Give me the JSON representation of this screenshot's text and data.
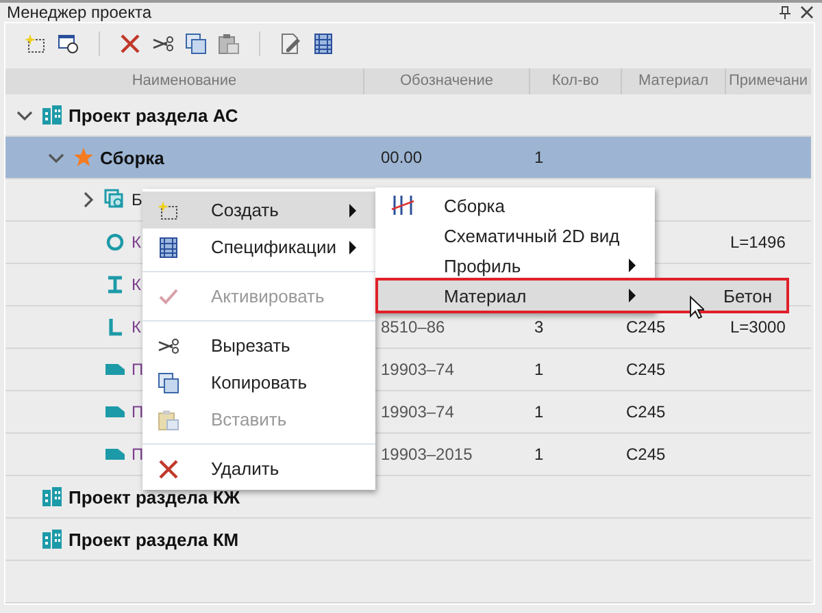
{
  "window": {
    "title": "Менеджер проекта"
  },
  "columns": [
    "Наименование",
    "Обозначение",
    "Кол-во",
    "Материал",
    "Примечани"
  ],
  "tree": [
    {
      "kind": "section",
      "name": "Проект раздела АС",
      "expanded": true,
      "selected": false,
      "children": [
        {
          "kind": "assembly",
          "name": "Сборка",
          "designation": "00.00",
          "quantity": "1",
          "expanded": true,
          "selected": true,
          "children": [
            {
              "kind": "group",
              "name": "Б",
              "expanded": false,
              "selected": false
            },
            {
              "kind": "ring",
              "name": "К",
              "note": "L=1496",
              "selected": false
            },
            {
              "kind": "ibeam",
              "name": "К",
              "selected": false
            },
            {
              "kind": "angle",
              "name": "К",
              "designation": "8510–86",
              "quantity": "3",
              "material": "С245",
              "note": "L=3000",
              "selected": false
            },
            {
              "kind": "plate",
              "name": "П",
              "designation": "19903–74",
              "quantity": "1",
              "material": "С245",
              "selected": false
            },
            {
              "kind": "plate",
              "name": "П",
              "designation": "19903–74",
              "quantity": "1",
              "material": "С245",
              "selected": false
            },
            {
              "kind": "plate",
              "name": "П",
              "designation": "19903–2015",
              "quantity": "1",
              "material": "С245",
              "selected": false
            }
          ]
        }
      ]
    },
    {
      "kind": "section",
      "name": "Проект раздела КЖ",
      "selected": false
    },
    {
      "kind": "section",
      "name": "Проект раздела КМ",
      "selected": false
    }
  ],
  "context_menu": {
    "items": [
      {
        "kind": "item",
        "label": "Создать",
        "submenu": true,
        "disabled": false,
        "selected": true
      },
      {
        "kind": "item",
        "label": "Спецификации",
        "submenu": true,
        "disabled": false,
        "selected": false
      },
      {
        "kind": "separator"
      },
      {
        "kind": "item",
        "label": "Активировать",
        "submenu": false,
        "disabled": true,
        "selected": false
      },
      {
        "kind": "separator"
      },
      {
        "kind": "item",
        "label": "Вырезать",
        "submenu": false,
        "disabled": false,
        "selected": false
      },
      {
        "kind": "item",
        "label": "Копировать",
        "submenu": false,
        "disabled": false,
        "selected": false
      },
      {
        "kind": "item",
        "label": "Вставить",
        "submenu": false,
        "disabled": true,
        "selected": false
      },
      {
        "kind": "separator"
      },
      {
        "kind": "item",
        "label": "Удалить",
        "submenu": false,
        "disabled": false,
        "selected": false
      }
    ]
  },
  "create_submenu": {
    "items": [
      {
        "kind": "item",
        "label": "Сборка",
        "submenu": false,
        "disabled": false,
        "selected": false
      },
      {
        "kind": "item",
        "label": "Схематичный 2D вид",
        "submenu": false,
        "disabled": false,
        "selected": false
      },
      {
        "kind": "item",
        "label": "Профиль",
        "submenu": true,
        "disabled": false,
        "selected": false
      },
      {
        "kind": "item",
        "label": "Материал",
        "submenu": true,
        "disabled": false,
        "selected": true
      }
    ]
  },
  "material_submenu": {
    "items": [
      {
        "kind": "item",
        "label": "Бетон",
        "submenu": false,
        "disabled": false,
        "selected": true
      }
    ]
  }
}
